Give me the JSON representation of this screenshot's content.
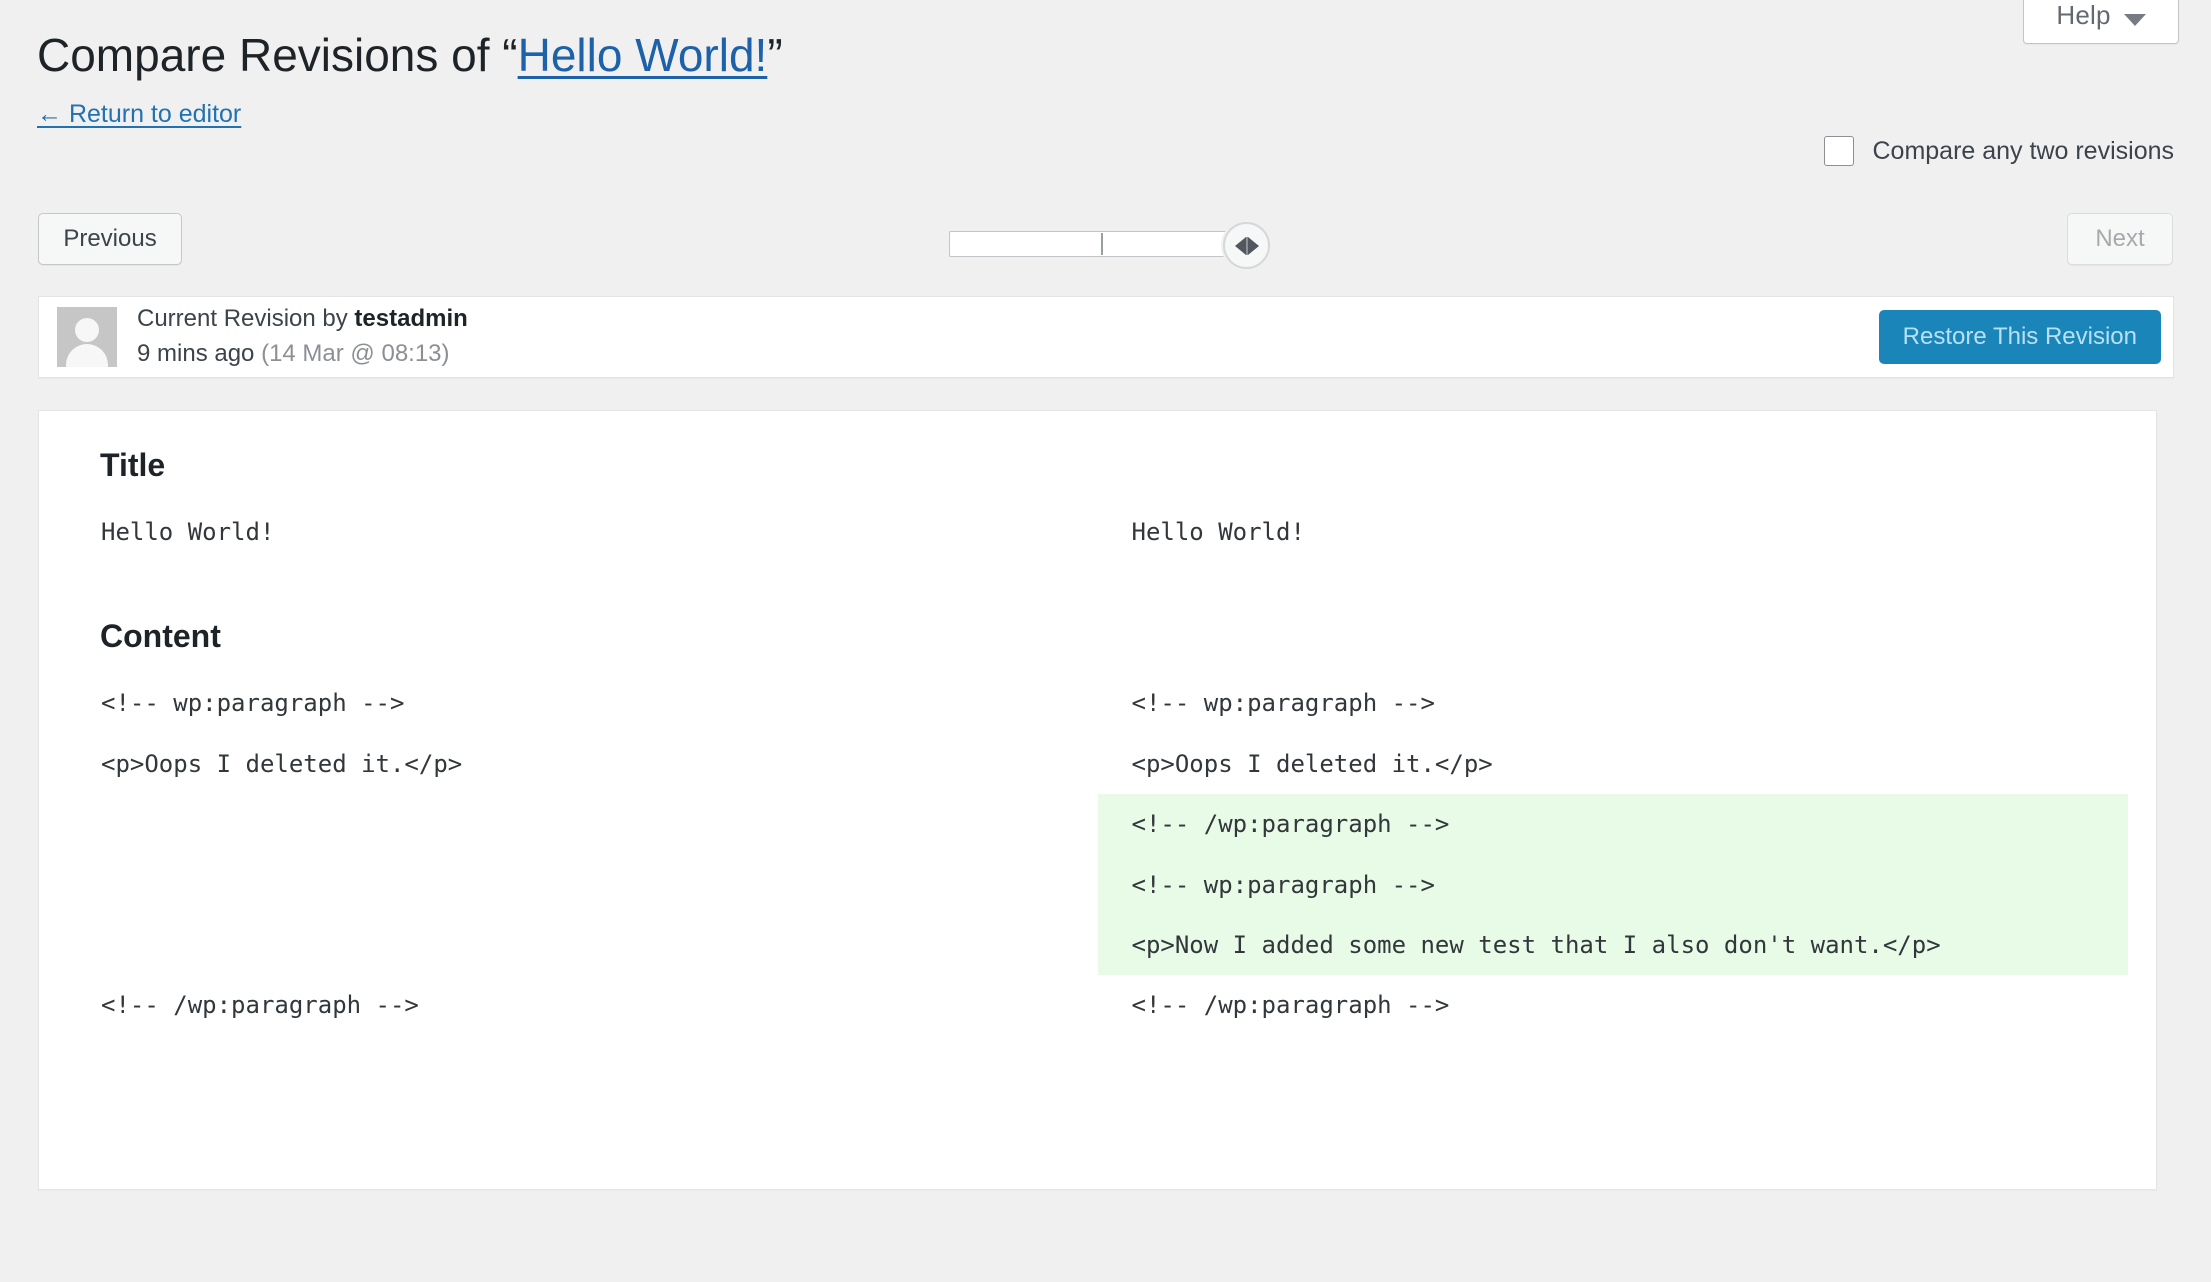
{
  "header": {
    "title_prefix": "Compare Revisions of “",
    "title_link": "Hello World!",
    "title_suffix": "”",
    "return_link": "← Return to editor",
    "help_label": "Help",
    "help_icon": "chevron-down-icon"
  },
  "compare": {
    "checkbox_label": "Compare any two revisions",
    "checked": false
  },
  "nav": {
    "previous_label": "Previous",
    "next_label": "Next",
    "next_disabled": true,
    "slider_position_percent": 100,
    "slider_handle_icon": "left-right-arrows-icon"
  },
  "revision": {
    "avatar_icon": "user-avatar-placeholder",
    "byline_prefix": "Current Revision by ",
    "author": "testadmin",
    "relative_time": "9 mins ago",
    "timestamp": "(14 Mar @ 08:13)",
    "restore_label": "Restore This Revision",
    "restore_disabled": true
  },
  "diff": {
    "title_heading": "Title",
    "content_heading": "Content",
    "colors": {
      "accent": "#2271b1",
      "restore_button": "#1a85b9",
      "added_row": "#e7fbe7",
      "page_background": "#f0f0f1"
    },
    "title_rows": [
      {
        "left": "Hello World!",
        "right": "Hello World!",
        "state": "unchanged"
      }
    ],
    "content_rows": [
      {
        "left": "<!-- wp:paragraph -->",
        "right": "<!-- wp:paragraph -->",
        "state": "unchanged"
      },
      {
        "left": "<p>Oops I deleted it.</p>",
        "right": "<p>Oops I deleted it.</p>",
        "state": "unchanged"
      },
      {
        "left": "",
        "right": "<!-- /wp:paragraph -->",
        "state": "added"
      },
      {
        "left": "",
        "right": "<!-- wp:paragraph -->",
        "state": "added"
      },
      {
        "left": "",
        "right": "<p>Now I added some new test that I also don't want.</p>",
        "state": "added"
      },
      {
        "left": "<!-- /wp:paragraph -->",
        "right": "<!-- /wp:paragraph -->",
        "state": "unchanged"
      }
    ]
  }
}
